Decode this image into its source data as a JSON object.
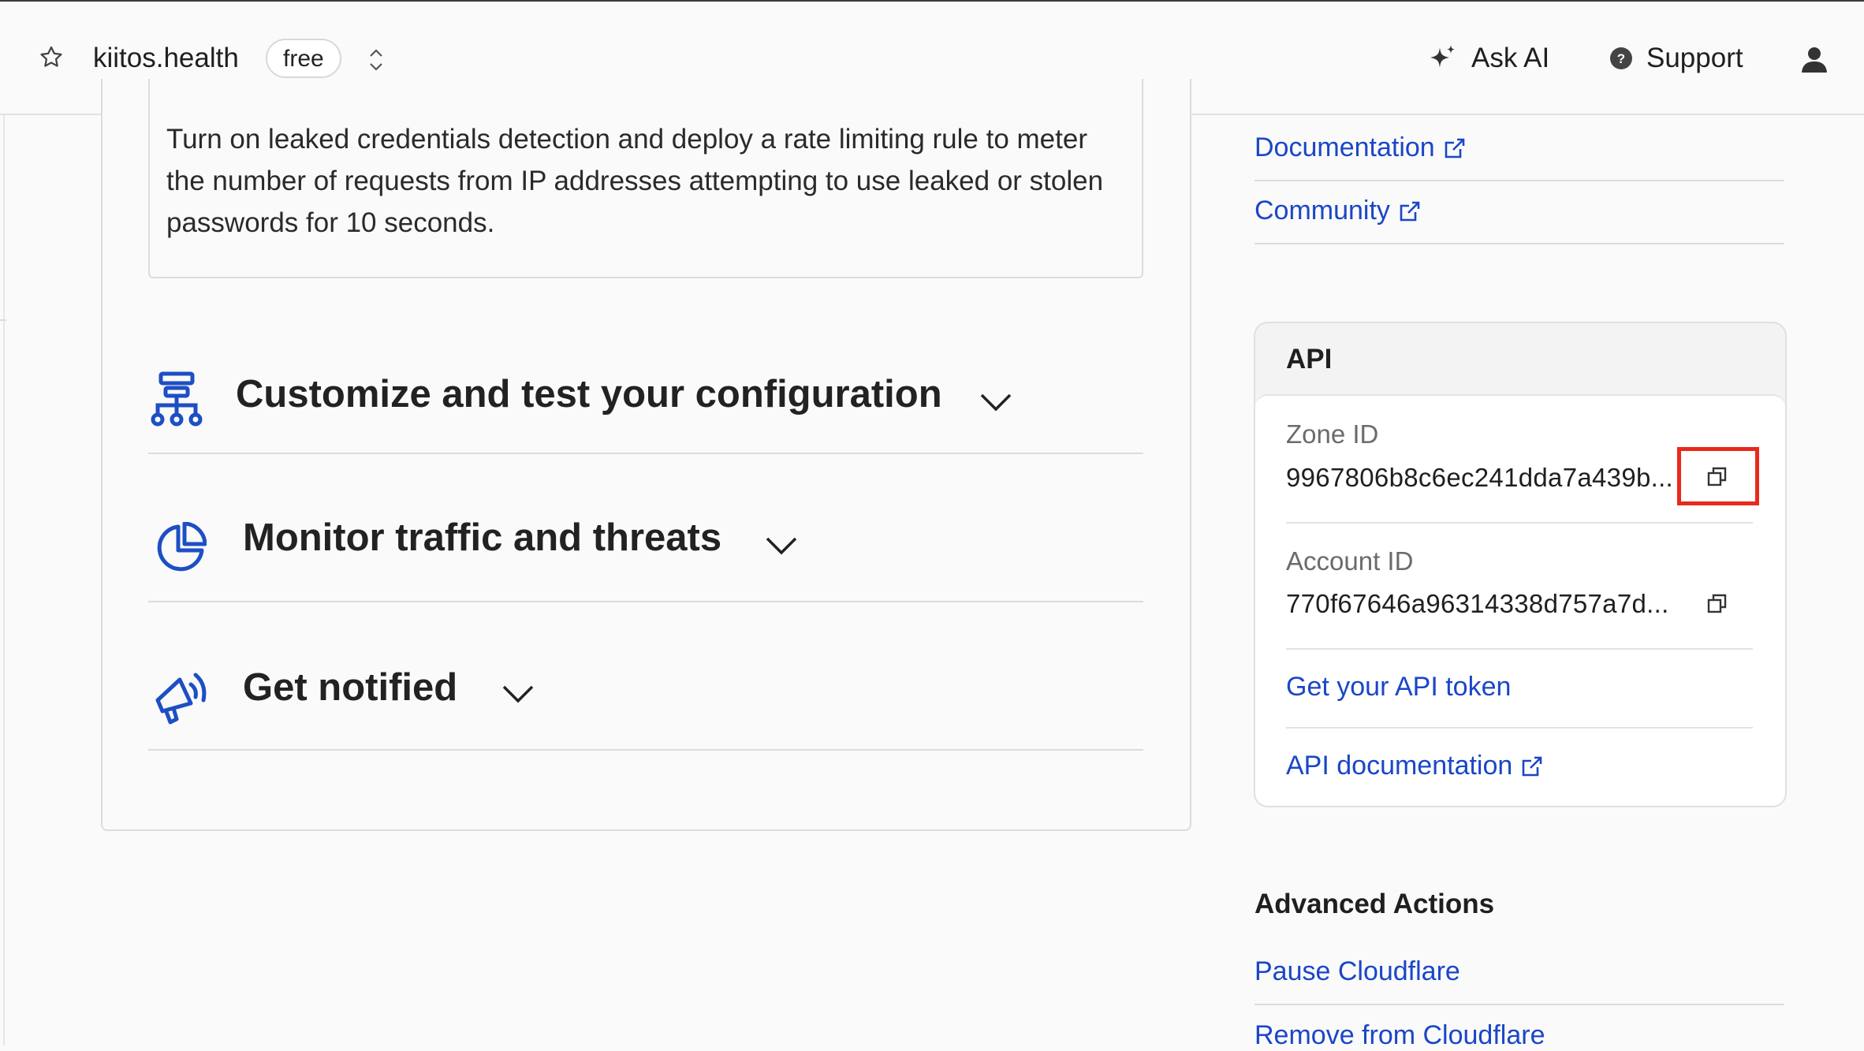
{
  "header": {
    "zone_name": "kiitos.health",
    "plan_badge": "free",
    "ask_ai_label": "Ask AI",
    "support_label": "Support"
  },
  "main": {
    "description": "Turn on leaked credentials detection and deploy a rate limiting rule to meter the number of requests from IP addresses attempting to use leaked or stolen passwords for 10 seconds.",
    "sections": [
      {
        "title": "Customize and test your configuration",
        "icon": "sitemap-icon"
      },
      {
        "title": "Monitor traffic and threats",
        "icon": "pie-chart-icon"
      },
      {
        "title": "Get notified",
        "icon": "megaphone-icon"
      }
    ]
  },
  "sidebar": {
    "resources": [
      {
        "label": "Documentation",
        "icon": "external-link-icon"
      },
      {
        "label": "Community",
        "icon": "external-link-icon"
      }
    ],
    "api": {
      "title": "API",
      "zone_id_label": "Zone ID",
      "zone_id_value": "9967806b8c6ec241dda7a439b...",
      "account_id_label": "Account ID",
      "account_id_value": "770f67646a96314338d757a7d...",
      "get_token_label": "Get your API token",
      "api_docs_label": "API documentation"
    },
    "advanced": {
      "title": "Advanced Actions",
      "pause_label": "Pause Cloudflare",
      "remove_label": "Remove from Cloudflare"
    }
  },
  "colors": {
    "link": "#1a46c8",
    "icon_blue": "#1d4fc4",
    "highlight": "#e8291c"
  }
}
